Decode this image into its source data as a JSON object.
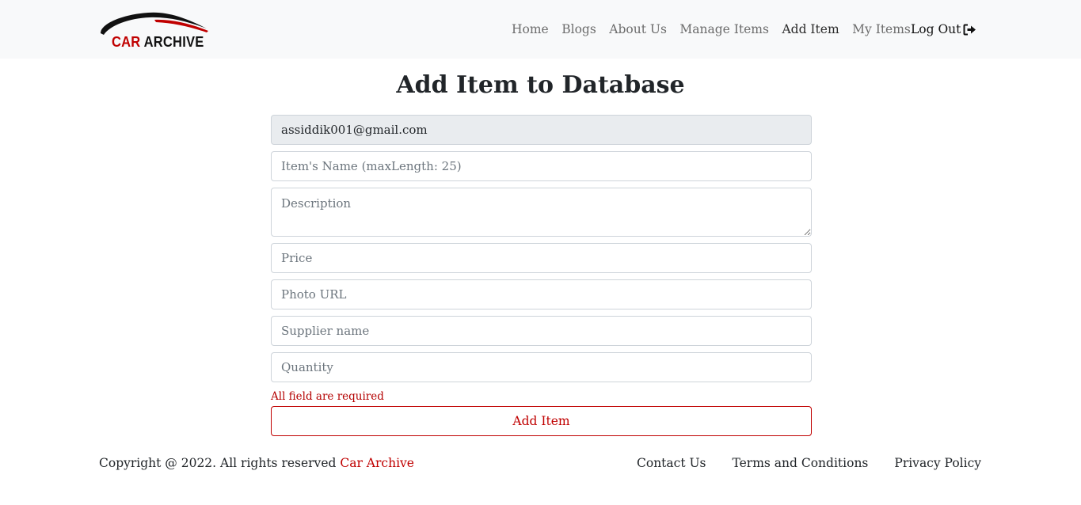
{
  "brand": {
    "name_part1": "CAR",
    "name_part2": "ARCHIVE",
    "logo_icon": "car-silhouette-icon",
    "accent": "#c00000"
  },
  "nav": {
    "items": [
      {
        "label": "Home"
      },
      {
        "label": "Blogs"
      },
      {
        "label": "About Us"
      },
      {
        "label": "Manage Items"
      },
      {
        "label": "Add Item"
      },
      {
        "label": "My Items"
      }
    ],
    "logout_label": "Log Out",
    "logout_icon": "sign-out-icon"
  },
  "page": {
    "title": "Add Item to Database"
  },
  "form": {
    "email_value": "assiddik001@gmail.com",
    "name_placeholder": "Item's Name (maxLength: 25)",
    "description_placeholder": "Description",
    "price_placeholder": "Price",
    "photo_placeholder": "Photo URL",
    "supplier_placeholder": "Supplier name",
    "quantity_placeholder": "Quantity",
    "error_text": "All field are required",
    "submit_label": "Add Item"
  },
  "footer": {
    "copyright": "Copyright @ 2022. All rights reserved",
    "brand_link": "Car Archive",
    "links": [
      {
        "label": "Contact Us"
      },
      {
        "label": "Terms and Conditions"
      },
      {
        "label": "Privacy Policy"
      }
    ]
  },
  "colors": {
    "accent": "#c00000",
    "navbar_bg": "#f8f9fa",
    "readonly_bg": "#e9ecef"
  }
}
